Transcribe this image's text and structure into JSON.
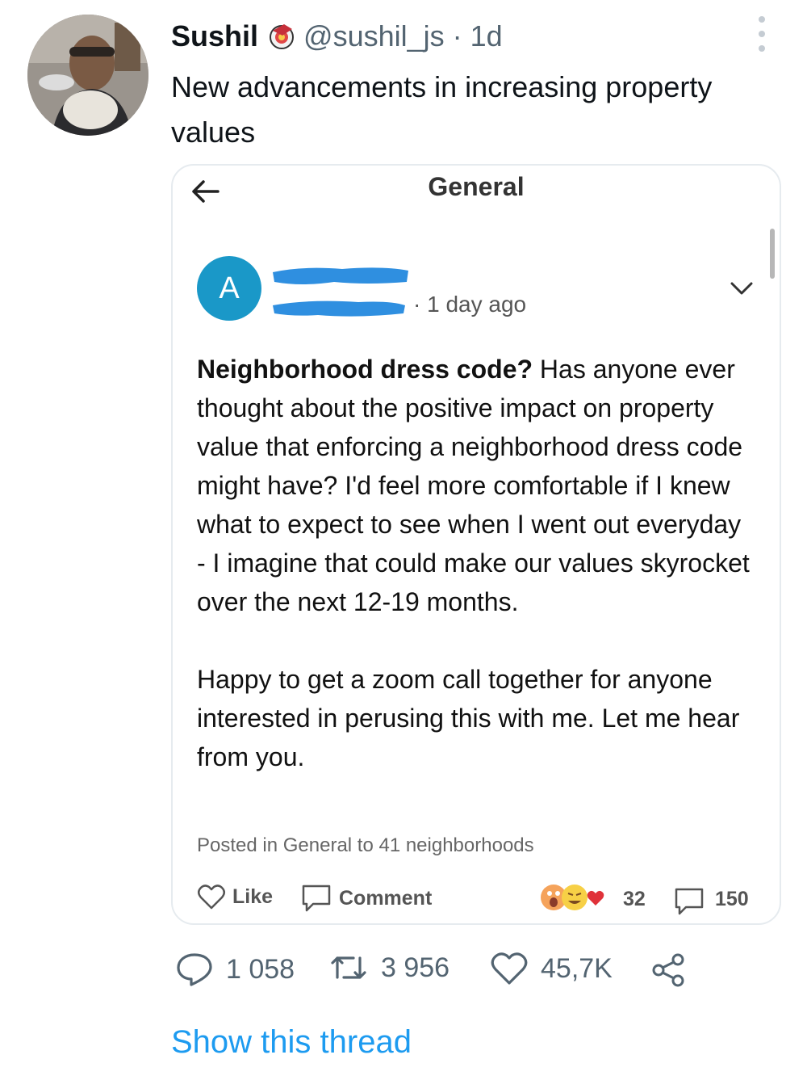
{
  "tweet": {
    "author_name": "Sushil",
    "author_handle": "@sushil_js",
    "separator": " · ",
    "time": "1d",
    "text": "New advancements in increasing property values"
  },
  "card": {
    "title": "General",
    "post": {
      "avatar_letter": "A",
      "time": "· 1 day ago",
      "title": "Neighborhood dress code?",
      "body_1": " Has anyone ever thought about the positive impact on property value that enforcing a neighborhood dress code might have? I'd feel more comfortable if I knew what to expect to see when I went out everyday - I imagine that could make our values skyrocket over the next 12-19 months.",
      "body_2": "Happy to get a zoom call together for anyone interested in perusing this with me. Let me hear from you.",
      "footnote": "Posted in General to 41 neighborhoods",
      "like_label": "Like",
      "comment_label": "Comment",
      "reaction_count": "32",
      "comment_count": "150"
    }
  },
  "actions": {
    "replies": "1 058",
    "retweets": "3 956",
    "likes": "45,7K"
  },
  "show_thread": "Show this thread",
  "colors": {
    "link": "#1d9bf0",
    "muted": "#536471",
    "post_avatar": "#1a98c8",
    "redaction": "#2f8fe0"
  },
  "icons": [
    "back-arrow-icon",
    "chevron-down-icon",
    "heart-icon",
    "comment-icon",
    "reply-icon",
    "retweet-icon",
    "share-icon",
    "more-icon"
  ]
}
